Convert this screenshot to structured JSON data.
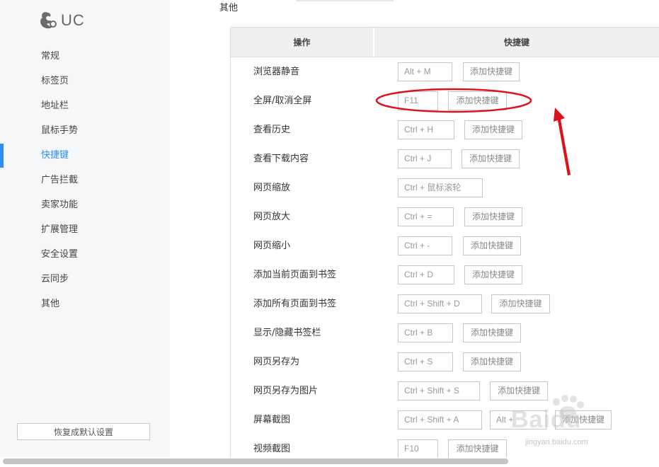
{
  "app": {
    "logo_text": "UC"
  },
  "sidebar": {
    "items": [
      {
        "label": "常规",
        "active": false
      },
      {
        "label": "标签页",
        "active": false
      },
      {
        "label": "地址栏",
        "active": false
      },
      {
        "label": "鼠标手势",
        "active": false
      },
      {
        "label": "快捷键",
        "active": true
      },
      {
        "label": "广告拦截",
        "active": false
      },
      {
        "label": "卖家功能",
        "active": false
      },
      {
        "label": "扩展管理",
        "active": false
      },
      {
        "label": "安全设置",
        "active": false
      },
      {
        "label": "云同步",
        "active": false
      },
      {
        "label": "其他",
        "active": false
      }
    ],
    "restore_label": "恢复成默认设置"
  },
  "main": {
    "section_label": "其他",
    "table": {
      "col_action": "操作",
      "col_shortcut": "快捷键",
      "rows": [
        {
          "name": "浏览器静音",
          "key": "Alt + M",
          "add": "添加快捷键"
        },
        {
          "name": "全屏/取消全屏",
          "key": "F11",
          "add": "添加快捷键"
        },
        {
          "name": "查看历史",
          "key": "Ctrl + H",
          "add": "添加快捷键"
        },
        {
          "name": "查看下载内容",
          "key": "Ctrl + J",
          "add": "添加快捷键"
        },
        {
          "name": "网页缩放",
          "key": "Ctrl + 鼠标滚轮"
        },
        {
          "name": "网页放大",
          "key": "Ctrl + =",
          "add": "添加快捷键"
        },
        {
          "name": "网页缩小",
          "key": "Ctrl + -",
          "add": "添加快捷键"
        },
        {
          "name": "添加当前页面到书签",
          "key": "Ctrl + D",
          "add": "添加快捷键"
        },
        {
          "name": "添加所有页面到书签",
          "key": "Ctrl + Shift + D",
          "add": "添加快捷键"
        },
        {
          "name": "显示/隐藏书签栏",
          "key": "Ctrl + B",
          "add": "添加快捷键"
        },
        {
          "name": "网页另存为",
          "key": "Ctrl + S",
          "add": "添加快捷键"
        },
        {
          "name": "网页另存为图片",
          "key": "Ctrl + Shift + S",
          "add": "添加快捷键"
        },
        {
          "name": "屏幕截图",
          "key": "Ctrl + Shift + A",
          "key2": "Alt +",
          "add": "添加快捷键"
        },
        {
          "name": "视频截图",
          "key": "F10",
          "add": "添加快捷键"
        }
      ]
    }
  },
  "watermark": {
    "brand": "Baidu",
    "site": "jingyan.baidu.com"
  },
  "colors": {
    "accent": "#2f8cf0",
    "annotation": "#e0101a"
  }
}
